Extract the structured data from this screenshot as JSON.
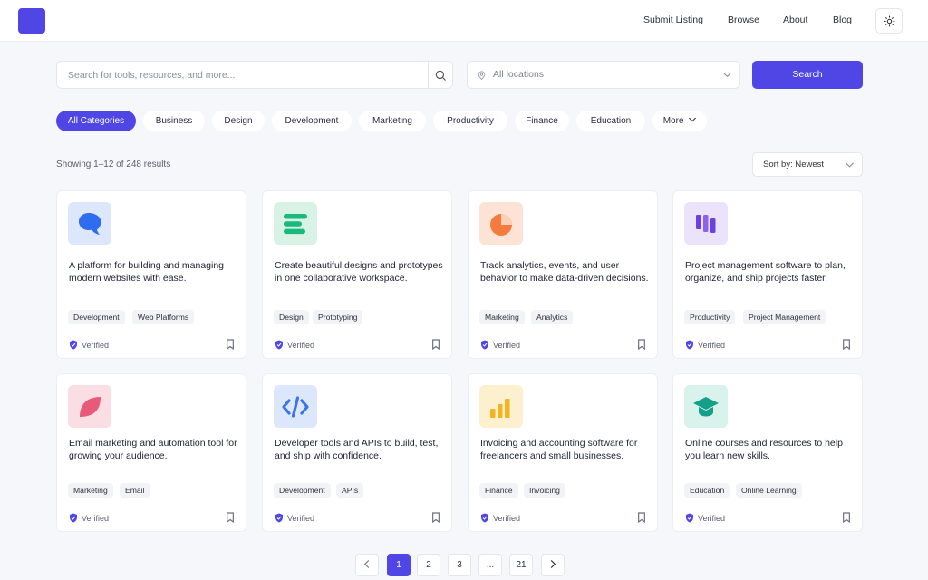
{
  "nav": {
    "links": [
      "Submit Listing",
      "Browse",
      "About",
      "Blog"
    ]
  },
  "search": {
    "placeholder": "Search for tools, resources, and more...",
    "location_label": "All locations",
    "button_label": "Search"
  },
  "categories": [
    "All Categories",
    "Business",
    "Design",
    "Development",
    "Marketing",
    "Productivity",
    "Finance",
    "Education",
    "More"
  ],
  "active_category": "All Categories",
  "results": {
    "count_text": "Showing 1–12 of 248 results",
    "sort_label": "Sort by: Newest"
  },
  "listings": [
    {
      "icon": "speech-bubble-icon",
      "icon_bg": "#dde7fb",
      "icon_color": "#2e6cf0",
      "description": "A platform for building and managing modern websites with ease.",
      "tags": [
        "Development",
        "Web Platforms"
      ],
      "verified_label": "Verified"
    },
    {
      "icon": "text-lines-icon",
      "icon_bg": "#d8f3e6",
      "icon_color": "#19b97a",
      "description": "Create beautiful designs and prototypes in one collaborative workspace.",
      "tags": [
        "Design",
        "Prototyping"
      ],
      "verified_label": "Verified"
    },
    {
      "icon": "pie-chart-icon",
      "icon_bg": "#fde3d6",
      "icon_color": "#f47b3d",
      "description": "Track analytics, events, and user behavior to make data-driven decisions.",
      "tags": [
        "Marketing",
        "Analytics"
      ],
      "verified_label": "Verified"
    },
    {
      "icon": "kanban-bars-icon",
      "icon_bg": "#ebe3fb",
      "icon_color": "#6b3fe0",
      "description": "Project management software to plan, organize, and ship projects faster.",
      "tags": [
        "Productivity",
        "Project Management"
      ],
      "verified_label": "Verified"
    },
    {
      "icon": "leaf-icon",
      "icon_bg": "#fbdde4",
      "icon_color": "#e8597a",
      "description": "Email marketing and automation tool for growing your audience.",
      "tags": [
        "Marketing",
        "Email"
      ],
      "verified_label": "Verified"
    },
    {
      "icon": "code-brackets-icon",
      "icon_bg": "#dde7fb",
      "icon_color": "#3a74e6",
      "description": "Developer tools and APIs to build, test, and ship with confidence.",
      "tags": [
        "Development",
        "APIs"
      ],
      "verified_label": "Verified"
    },
    {
      "icon": "bar-chart-icon",
      "icon_bg": "#fcf0cf",
      "icon_color": "#f2b41f",
      "description": "Invoicing and accounting software for freelancers and small businesses.",
      "tags": [
        "Finance",
        "Invoicing"
      ],
      "verified_label": "Verified"
    },
    {
      "icon": "graduation-cap-icon",
      "icon_bg": "#d8f2ec",
      "icon_color": "#14a088",
      "description": "Online courses and resources to help you learn new skills.",
      "tags": [
        "Education",
        "Online Learning"
      ],
      "verified_label": "Verified"
    }
  ],
  "pagination": {
    "prev_icon": "chevron-left-icon",
    "pages": [
      "1",
      "2",
      "3",
      "...",
      "21"
    ],
    "current": "1",
    "next_icon": "chevron-right-icon"
  },
  "colors": {
    "accent": "#4f46e5",
    "background": "#f6f7fa"
  }
}
